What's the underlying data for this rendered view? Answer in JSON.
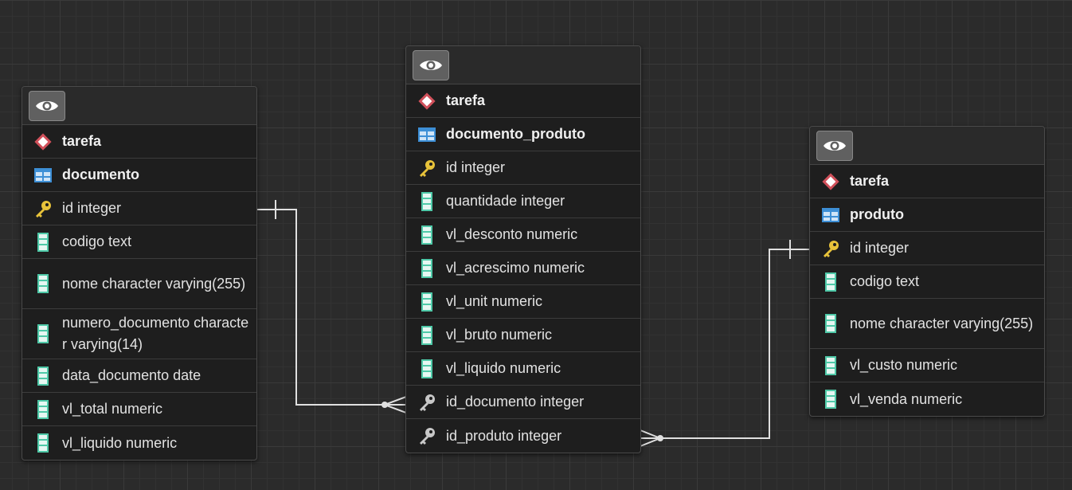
{
  "tables": [
    {
      "id": "documento",
      "schema": "tarefa",
      "name": "documento",
      "columns": [
        {
          "label": "id integer",
          "icon": "primary-key-icon"
        },
        {
          "label": "codigo text",
          "icon": "column-icon"
        },
        {
          "label": "nome character varying(255)",
          "icon": "column-icon"
        },
        {
          "label": "numero_documento character varying(14)",
          "icon": "column-icon"
        },
        {
          "label": "data_documento date",
          "icon": "column-icon"
        },
        {
          "label": "vl_total numeric",
          "icon": "column-icon"
        },
        {
          "label": "vl_liquido numeric",
          "icon": "column-icon"
        }
      ]
    },
    {
      "id": "documento_produto",
      "schema": "tarefa",
      "name": "documento_produto",
      "columns": [
        {
          "label": "id integer",
          "icon": "primary-key-icon"
        },
        {
          "label": "quantidade integer",
          "icon": "column-icon"
        },
        {
          "label": "vl_desconto numeric",
          "icon": "column-icon"
        },
        {
          "label": "vl_acrescimo numeric",
          "icon": "column-icon"
        },
        {
          "label": "vl_unit numeric",
          "icon": "column-icon"
        },
        {
          "label": "vl_bruto numeric",
          "icon": "column-icon"
        },
        {
          "label": "vl_liquido numeric",
          "icon": "column-icon"
        },
        {
          "label": "id_documento integer",
          "icon": "foreign-key-icon"
        },
        {
          "label": "id_produto integer",
          "icon": "foreign-key-icon"
        }
      ]
    },
    {
      "id": "produto",
      "schema": "tarefa",
      "name": "produto",
      "columns": [
        {
          "label": "id integer",
          "icon": "primary-key-icon"
        },
        {
          "label": "codigo text",
          "icon": "column-icon"
        },
        {
          "label": "nome character varying(255)",
          "icon": "column-icon"
        },
        {
          "label": "vl_custo numeric",
          "icon": "column-icon"
        },
        {
          "label": "vl_venda numeric",
          "icon": "column-icon"
        }
      ]
    }
  ],
  "relationships": [
    {
      "from": "documento.id",
      "to": "documento_produto.id_documento",
      "cardinality": "one-to-many"
    },
    {
      "from": "produto.id",
      "to": "documento_produto.id_produto",
      "cardinality": "one-to-many"
    }
  ],
  "colors": {
    "background": "#2b2b2b",
    "table_bg": "#1e1e1e",
    "schema_icon": "#d0505a",
    "table_icon": "#3d8fd6",
    "key_icon": "#e8c33a",
    "column_icon": "#4fc9a8",
    "connector": "#e0e0e0"
  }
}
